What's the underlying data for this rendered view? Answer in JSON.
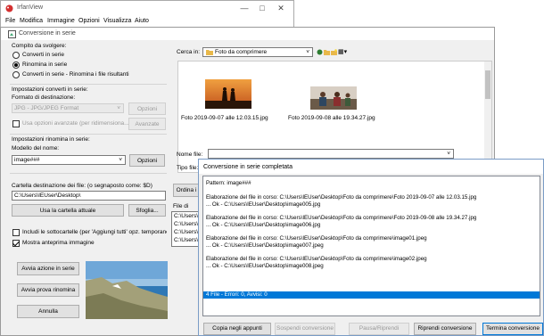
{
  "main_window": {
    "title": "IrfanView",
    "menu": [
      "File",
      "Modifica",
      "Immagine",
      "Opzioni",
      "Visualizza",
      "Aiuto"
    ],
    "controls": [
      "—",
      "□",
      "✕"
    ]
  },
  "batch": {
    "title": "Conversione in serie",
    "task_label": "Compito da svolgere:",
    "radio_options": [
      "Converti in serie",
      "Rinomina in serie",
      "Converti in serie - Rinomina i file risultanti"
    ],
    "selected_radio": 1,
    "convert_section": {
      "heading": "Impostazioni converti in serie:",
      "format_label": "Formato di destinazione:",
      "format_value": "JPG - JPG/JPEG Format",
      "options_button": "Opzioni",
      "advanced_checkbox": "Usa opzioni avanzate (per ridimensiona...)",
      "advanced_button": "Avanzate"
    },
    "rename_section": {
      "heading": "Impostazioni rinomina in serie:",
      "pattern_label": "Modello del nome:",
      "pattern_value": "image###",
      "options_button": "Opzioni"
    },
    "dest_section": {
      "label": "Cartella destinazione dei file: (o segnaposto come: $D)",
      "path": "C:\\Users\\IEUser\\Desktop\\",
      "use_current_button": "Usa la cartella attuale",
      "browse_button": "Sfoglia..."
    },
    "checkboxes": [
      {
        "label": "Includi le sottocartelle (per 'Aggiungi tutti' opz. temporanee",
        "checked": false
      },
      {
        "label": "Mostra anteprima immagine",
        "checked": true
      }
    ],
    "action_buttons": [
      "Avvia azione in serie",
      "Avvia prova rinomina",
      "Annulla"
    ],
    "browser": {
      "look_in_label": "Cerca in:",
      "look_in_value": "Foto da comprimere",
      "files": [
        "Foto 2019-09-07 alle 12.03.15.jpg",
        "Foto 2019-09-08 alle 19.34.27.jpg"
      ]
    },
    "file_name_label": "Nome file:",
    "file_type_label": "Tipo file:",
    "sort_button": "Ordina i",
    "input_files_label": "File di",
    "input_files": [
      "C:\\Users\\",
      "C:\\Users\\",
      "C:\\Users\\",
      "C:\\Users\\"
    ]
  },
  "done_dialog": {
    "title": "Conversione in serie completata",
    "log": [
      "Pattern: image###",
      "",
      "Elaborazione del file in corso: C:\\Users\\IEUser\\Desktop\\Foto da comprimere\\Foto 2019-09-07 alle 12.03.15.jpg",
      "... Ok - C:\\Users\\IEUser\\Desktop\\image005.jpg",
      "",
      "Elaborazione del file in corso: C:\\Users\\IEUser\\Desktop\\Foto da comprimere\\Foto 2019-09-08 alle 19.34.27.jpg",
      "... Ok - C:\\Users\\IEUser\\Desktop\\image006.jpg",
      "",
      "Elaborazione del file in corso: C:\\Users\\IEUser\\Desktop\\Foto da comprimere\\image01.jpeg",
      "... Ok - C:\\Users\\IEUser\\Desktop\\image007.jpeg",
      "",
      "Elaborazione del file in corso: C:\\Users\\IEUser\\Desktop\\Foto da comprimere\\image02.jpeg",
      "... Ok - C:\\Users\\IEUser\\Desktop\\image008.jpeg"
    ],
    "summary": "4 File - Errori: 0, Avvisi: 0",
    "buttons": [
      "Copia negli appunti",
      "Sospendi conversione",
      "Pausa/Riprendi",
      "Riprendi conversione",
      "Termina conversione"
    ]
  },
  "colors": {
    "selection": "#0078d7",
    "window_bg": "#f0f0f0"
  }
}
